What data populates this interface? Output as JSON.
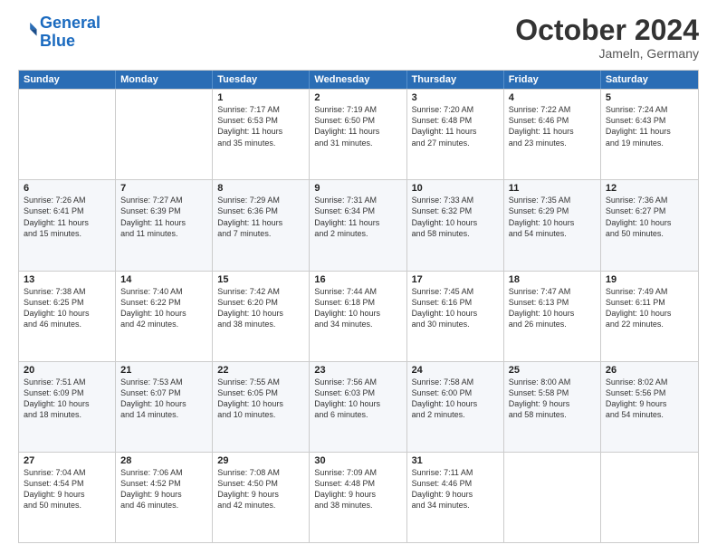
{
  "header": {
    "logo_line1": "General",
    "logo_line2": "Blue",
    "month": "October 2024",
    "location": "Jameln, Germany"
  },
  "days_of_week": [
    "Sunday",
    "Monday",
    "Tuesday",
    "Wednesday",
    "Thursday",
    "Friday",
    "Saturday"
  ],
  "weeks": [
    [
      {
        "day": "",
        "info": ""
      },
      {
        "day": "",
        "info": ""
      },
      {
        "day": "1",
        "info": "Sunrise: 7:17 AM\nSunset: 6:53 PM\nDaylight: 11 hours\nand 35 minutes."
      },
      {
        "day": "2",
        "info": "Sunrise: 7:19 AM\nSunset: 6:50 PM\nDaylight: 11 hours\nand 31 minutes."
      },
      {
        "day": "3",
        "info": "Sunrise: 7:20 AM\nSunset: 6:48 PM\nDaylight: 11 hours\nand 27 minutes."
      },
      {
        "day": "4",
        "info": "Sunrise: 7:22 AM\nSunset: 6:46 PM\nDaylight: 11 hours\nand 23 minutes."
      },
      {
        "day": "5",
        "info": "Sunrise: 7:24 AM\nSunset: 6:43 PM\nDaylight: 11 hours\nand 19 minutes."
      }
    ],
    [
      {
        "day": "6",
        "info": "Sunrise: 7:26 AM\nSunset: 6:41 PM\nDaylight: 11 hours\nand 15 minutes."
      },
      {
        "day": "7",
        "info": "Sunrise: 7:27 AM\nSunset: 6:39 PM\nDaylight: 11 hours\nand 11 minutes."
      },
      {
        "day": "8",
        "info": "Sunrise: 7:29 AM\nSunset: 6:36 PM\nDaylight: 11 hours\nand 7 minutes."
      },
      {
        "day": "9",
        "info": "Sunrise: 7:31 AM\nSunset: 6:34 PM\nDaylight: 11 hours\nand 2 minutes."
      },
      {
        "day": "10",
        "info": "Sunrise: 7:33 AM\nSunset: 6:32 PM\nDaylight: 10 hours\nand 58 minutes."
      },
      {
        "day": "11",
        "info": "Sunrise: 7:35 AM\nSunset: 6:29 PM\nDaylight: 10 hours\nand 54 minutes."
      },
      {
        "day": "12",
        "info": "Sunrise: 7:36 AM\nSunset: 6:27 PM\nDaylight: 10 hours\nand 50 minutes."
      }
    ],
    [
      {
        "day": "13",
        "info": "Sunrise: 7:38 AM\nSunset: 6:25 PM\nDaylight: 10 hours\nand 46 minutes."
      },
      {
        "day": "14",
        "info": "Sunrise: 7:40 AM\nSunset: 6:22 PM\nDaylight: 10 hours\nand 42 minutes."
      },
      {
        "day": "15",
        "info": "Sunrise: 7:42 AM\nSunset: 6:20 PM\nDaylight: 10 hours\nand 38 minutes."
      },
      {
        "day": "16",
        "info": "Sunrise: 7:44 AM\nSunset: 6:18 PM\nDaylight: 10 hours\nand 34 minutes."
      },
      {
        "day": "17",
        "info": "Sunrise: 7:45 AM\nSunset: 6:16 PM\nDaylight: 10 hours\nand 30 minutes."
      },
      {
        "day": "18",
        "info": "Sunrise: 7:47 AM\nSunset: 6:13 PM\nDaylight: 10 hours\nand 26 minutes."
      },
      {
        "day": "19",
        "info": "Sunrise: 7:49 AM\nSunset: 6:11 PM\nDaylight: 10 hours\nand 22 minutes."
      }
    ],
    [
      {
        "day": "20",
        "info": "Sunrise: 7:51 AM\nSunset: 6:09 PM\nDaylight: 10 hours\nand 18 minutes."
      },
      {
        "day": "21",
        "info": "Sunrise: 7:53 AM\nSunset: 6:07 PM\nDaylight: 10 hours\nand 14 minutes."
      },
      {
        "day": "22",
        "info": "Sunrise: 7:55 AM\nSunset: 6:05 PM\nDaylight: 10 hours\nand 10 minutes."
      },
      {
        "day": "23",
        "info": "Sunrise: 7:56 AM\nSunset: 6:03 PM\nDaylight: 10 hours\nand 6 minutes."
      },
      {
        "day": "24",
        "info": "Sunrise: 7:58 AM\nSunset: 6:00 PM\nDaylight: 10 hours\nand 2 minutes."
      },
      {
        "day": "25",
        "info": "Sunrise: 8:00 AM\nSunset: 5:58 PM\nDaylight: 9 hours\nand 58 minutes."
      },
      {
        "day": "26",
        "info": "Sunrise: 8:02 AM\nSunset: 5:56 PM\nDaylight: 9 hours\nand 54 minutes."
      }
    ],
    [
      {
        "day": "27",
        "info": "Sunrise: 7:04 AM\nSunset: 4:54 PM\nDaylight: 9 hours\nand 50 minutes."
      },
      {
        "day": "28",
        "info": "Sunrise: 7:06 AM\nSunset: 4:52 PM\nDaylight: 9 hours\nand 46 minutes."
      },
      {
        "day": "29",
        "info": "Sunrise: 7:08 AM\nSunset: 4:50 PM\nDaylight: 9 hours\nand 42 minutes."
      },
      {
        "day": "30",
        "info": "Sunrise: 7:09 AM\nSunset: 4:48 PM\nDaylight: 9 hours\nand 38 minutes."
      },
      {
        "day": "31",
        "info": "Sunrise: 7:11 AM\nSunset: 4:46 PM\nDaylight: 9 hours\nand 34 minutes."
      },
      {
        "day": "",
        "info": ""
      },
      {
        "day": "",
        "info": ""
      }
    ]
  ]
}
